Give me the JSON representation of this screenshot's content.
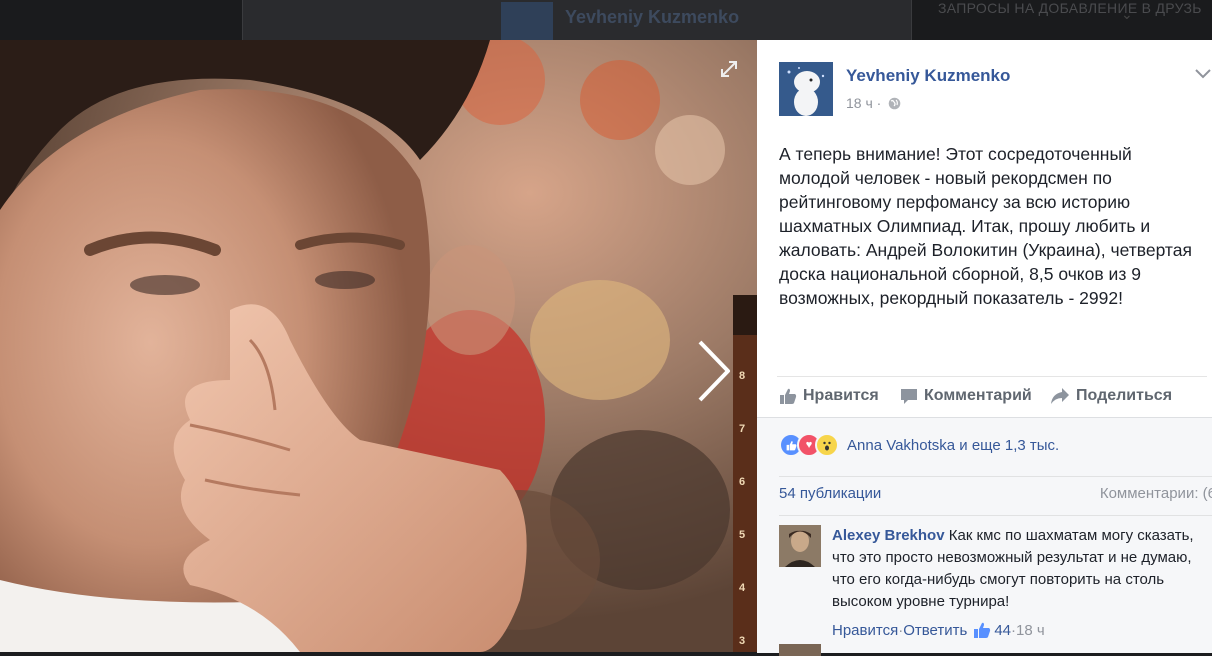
{
  "background": {
    "post_author": "Yevheniy Kuzmenko",
    "sidebar_heading": "ЗАПРОСЫ НА ДОБАВЛЕНИЕ В ДРУЗЬ"
  },
  "photo": {
    "board_ranks": [
      "8",
      "7",
      "6",
      "5",
      "4",
      "3"
    ]
  },
  "post": {
    "author": "Yevheniy Kuzmenko",
    "time": "18 ч",
    "separator": "·",
    "text": "А теперь внимание! Этот сосредоточенный молодой человек - новый рекордсмен по рейтинговому перфомансу за всю историю шахматных Олимпиад. Итак, прошу любить и жаловать: Андрей Волокитин (Украина), четвертая доска национальной сборной, 8,5 очков из 9 возможных, рекордный показатель - 2992!",
    "actions": {
      "like": "Нравится",
      "comment": "Комментарий",
      "share": "Поделиться"
    },
    "reactions_text": "Anna Vakhotska и еще 1,3 тыс.",
    "shares": "54 публикации",
    "comments_selector": "Комментарии: (6"
  },
  "comment": {
    "author": "Alexey Brekhov",
    "text": "Как кмс по шахматам могу сказать, что это просто невозможный результат и не думаю, что его когда-нибудь смогут повторить на столь высоком уровне турнира!",
    "like": "Нравится",
    "reply": "Ответить",
    "likes": "44",
    "time": "18 ч",
    "sep": " · "
  },
  "colors": {
    "link": "#365899",
    "meta": "#90949c",
    "text": "#1d2129",
    "like_blue": "#5890ff"
  }
}
